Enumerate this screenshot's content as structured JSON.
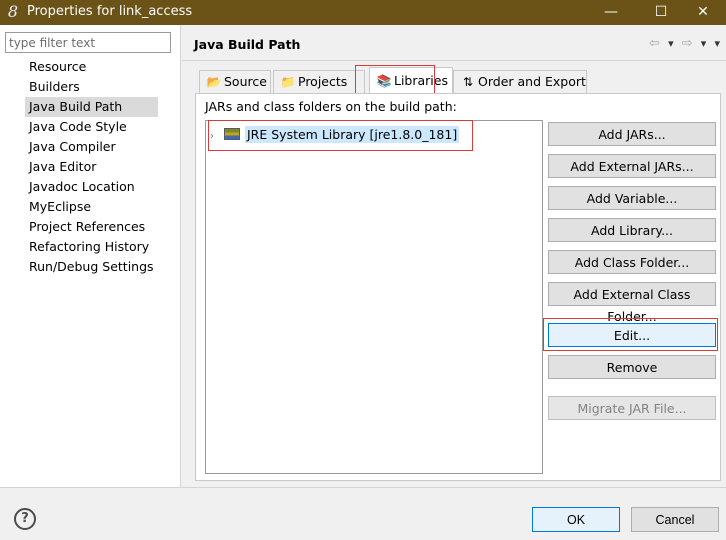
{
  "window": {
    "title": "Properties for link_access",
    "app_icon": "eclipse-icon",
    "controls": {
      "minimize": "—",
      "maximize": "☐",
      "close": "✕"
    }
  },
  "sidebar": {
    "filter_placeholder": "type filter text",
    "items": [
      {
        "label": "Resource"
      },
      {
        "label": "Builders"
      },
      {
        "label": "Java Build Path",
        "selected": true
      },
      {
        "label": "Java Code Style"
      },
      {
        "label": "Java Compiler"
      },
      {
        "label": "Java Editor"
      },
      {
        "label": "Javadoc Location"
      },
      {
        "label": "MyEclipse"
      },
      {
        "label": "Project References"
      },
      {
        "label": "Refactoring History"
      },
      {
        "label": "Run/Debug Settings"
      }
    ]
  },
  "header": {
    "title": "Java Build Path",
    "nav": {
      "back": "⇦",
      "back_menu": "▾",
      "forward": "⇨",
      "forward_menu": "▾",
      "view_menu": "▾"
    }
  },
  "tabs": [
    {
      "label": "Source",
      "icon": "source-folder-icon",
      "glyph": "📂"
    },
    {
      "label": "Projects",
      "icon": "projects-icon",
      "glyph": "📁"
    },
    {
      "label": "Libraries",
      "icon": "libraries-icon",
      "glyph": "📚",
      "active": true
    },
    {
      "label": "Order and Export",
      "icon": "order-export-icon",
      "glyph": "⇅"
    }
  ],
  "libraries": {
    "heading": "JARs and class folders on the build path:",
    "tree": [
      {
        "label": "JRE System Library [jre1.8.0_181]",
        "expander": "›",
        "icon": "jre-library-icon",
        "selected": true
      }
    ],
    "buttons": {
      "add_jars": "Add JARs...",
      "add_external_jars": "Add External JARs...",
      "add_variable": "Add Variable...",
      "add_library": "Add Library...",
      "add_class_folder": "Add Class Folder...",
      "add_external_class_folder": "Add External Class Folder...",
      "edit": "Edit...",
      "remove": "Remove",
      "migrate_jar": "Migrate JAR File..."
    }
  },
  "footer": {
    "help": "?",
    "ok": "OK",
    "cancel": "Cancel"
  },
  "colors": {
    "titlebar": "#6b5317",
    "selection": "#cce8ff",
    "highlight_box": "#d93a3a",
    "focus_border": "#0078d7"
  }
}
